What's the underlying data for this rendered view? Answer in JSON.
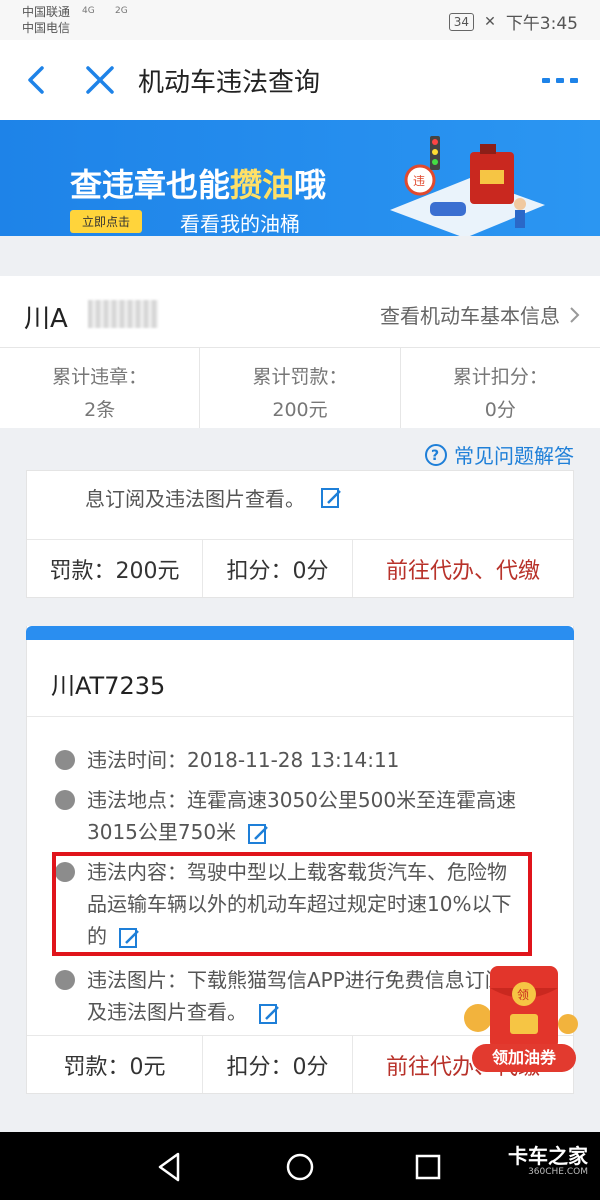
{
  "status_bar": {
    "carrier1": "中国联通",
    "carrier2": "中国电信",
    "signal1": "4G",
    "signal2": "2G",
    "battery": "34",
    "time": "下午3:45"
  },
  "nav": {
    "title": "机动车违法查询"
  },
  "banner": {
    "title_part1": "查违章也能",
    "title_highlight": "攒油",
    "title_part2": "哦",
    "button": "立即点击",
    "subtitle": "看看我的油桶",
    "sign_text": "违"
  },
  "vehicle": {
    "plate_partial": "川A",
    "basic_info_link": "查看机动车基本信息"
  },
  "stats": [
    {
      "label": "累计违章：",
      "value": "2条"
    },
    {
      "label": "累计罚款：",
      "value": "200元"
    },
    {
      "label": "累计扣分：",
      "value": "0分"
    }
  ],
  "faq": {
    "label": "常见问题解答"
  },
  "card1": {
    "tail_text": "息订阅及违法图片查看。",
    "fine": "罚款：200元",
    "points": "扣分：0分",
    "action": "前往代办、代缴"
  },
  "card2": {
    "plate": "川AT7235",
    "violation_time": "违法时间：2018-11-28 13:14:11",
    "violation_location": "违法地点：连霍高速3050公里500米至连霍高速3015公里750米",
    "violation_content": "违法内容：驾驶中型以上载客载货汽车、危险物品运输车辆以外的机动车超过规定时速10%以下的",
    "violation_photo": "违法图片：下载熊猫驾信APP进行免费信息订阅及违法图片查看。",
    "fine": "罚款：0元",
    "points": "扣分：0分",
    "action": "前往代办、代缴"
  },
  "red_packet": {
    "icon_text": "领",
    "label": "领加油券"
  },
  "watermark": {
    "text": "卡车之家",
    "url": "360CHE.COM"
  },
  "colors": {
    "accent": "#1e83e8",
    "banner_yellow": "#ffd43b",
    "highlight_red": "#e0141b",
    "action_red": "#b8322a"
  }
}
